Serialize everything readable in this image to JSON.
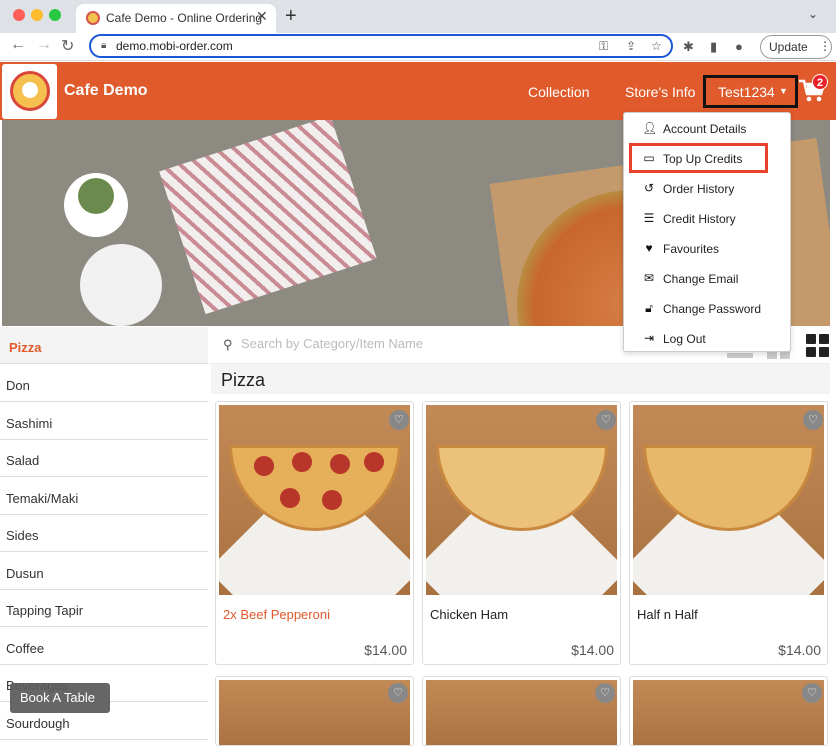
{
  "browser": {
    "tab_title": "Cafe Demo - Online Ordering",
    "url": "demo.mobi-order.com",
    "update_label": "Update"
  },
  "header": {
    "brand": "Cafe Demo",
    "nav": [
      "Collection",
      "Store's Info"
    ],
    "user": "Test1234",
    "cart_count": "2",
    "accent_color": "#e05a2b"
  },
  "account_menu": [
    {
      "label": "Account Details",
      "icon": "user-icon"
    },
    {
      "label": "Top Up Credits",
      "icon": "credit-card-icon"
    },
    {
      "label": "Order History",
      "icon": "history-icon"
    },
    {
      "label": "Credit History",
      "icon": "list-icon"
    },
    {
      "label": "Favourites",
      "icon": "heart-icon"
    },
    {
      "label": "Change Email",
      "icon": "envelope-icon"
    },
    {
      "label": "Change Password",
      "icon": "unlock-icon"
    },
    {
      "label": "Log Out",
      "icon": "logout-icon"
    }
  ],
  "categories": [
    "Pizza",
    "Don",
    "Sashimi",
    "Salad",
    "Temaki/Maki",
    "Sides",
    "Dusun",
    "Tapping Tapir",
    "Coffee",
    "Beverages",
    "Sourdough"
  ],
  "search": {
    "placeholder": "Search by Category/Item Name"
  },
  "section_title": "Pizza",
  "products": [
    {
      "name": "2x Beef Pepperoni",
      "price": "$14.00"
    },
    {
      "name": "Chicken Ham",
      "price": "$14.00"
    },
    {
      "name": "Half n Half",
      "price": "$14.00"
    }
  ],
  "book_table_label": "Book A Table"
}
